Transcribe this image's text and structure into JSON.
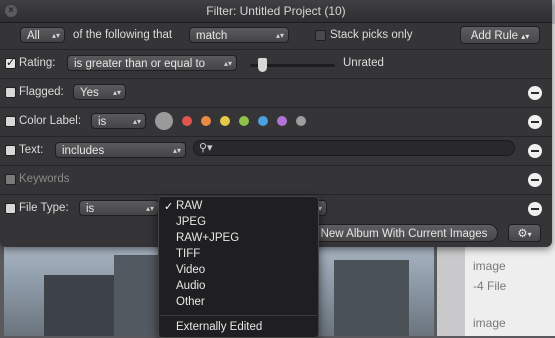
{
  "window": {
    "title": "Filter: Untitled Project (10)"
  },
  "header": {
    "match_scope": "All",
    "of_following": "of the following that",
    "match_mode": "match",
    "stack_picks_label": "Stack picks only",
    "add_rule": "Add Rule"
  },
  "rules": {
    "rating": {
      "label": "Rating:",
      "operator": "is greater than or equal to",
      "value_label": "Unrated",
      "slider_fraction": 0
    },
    "flagged": {
      "label": "Flagged:",
      "value": "Yes"
    },
    "color_label": {
      "label": "Color Label:",
      "operator": "is",
      "colors": [
        "#9a9a9a",
        "#e0564e",
        "#e98b45",
        "#e4c94a",
        "#8dc24b",
        "#4aa0e0",
        "#b074d6",
        "#9e9e9e"
      ]
    },
    "text": {
      "label": "Text:",
      "operator": "includes",
      "value": ""
    },
    "keywords": {
      "label": "Keywords"
    },
    "file_type": {
      "label": "File Type:",
      "operator": "is"
    }
  },
  "footer": {
    "new_album_button": "New Album With Current Images"
  },
  "file_type_menu": {
    "selected": "RAW",
    "items": [
      "JPEG",
      "RAW+JPEG",
      "TIFF",
      "Video",
      "Audio",
      "Other"
    ],
    "extra": "Externally Edited"
  },
  "background": {
    "items": [
      "image",
      "image",
      "-4 File",
      "image"
    ]
  }
}
